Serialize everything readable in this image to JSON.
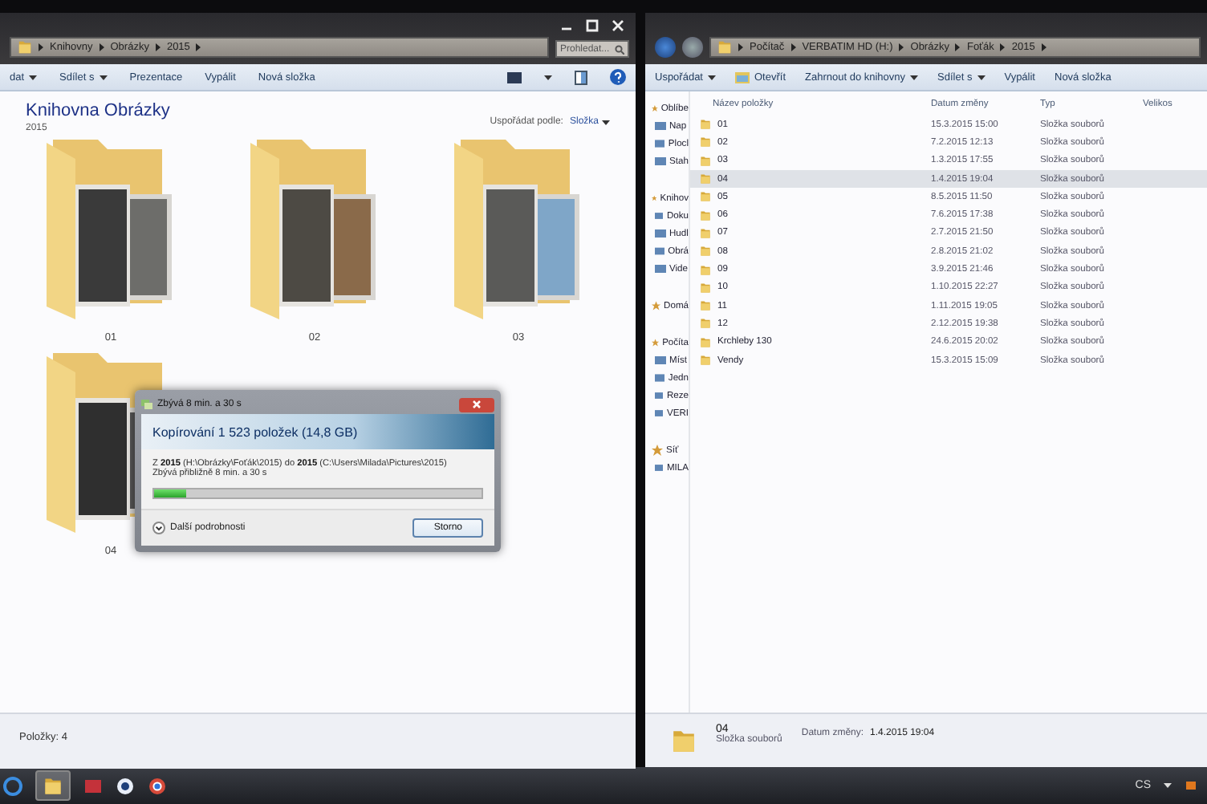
{
  "left_window": {
    "breadcrumbs": [
      "Knihovny",
      "Obrázky",
      "2015"
    ],
    "search": {
      "placeholder": "Prohledat..."
    },
    "toolbar": [
      {
        "label": "dat",
        "dropdown": true
      },
      {
        "label": "Sdílet s",
        "dropdown": true
      },
      {
        "label": "Prezentace",
        "dropdown": false
      },
      {
        "label": "Vypálit",
        "dropdown": false
      },
      {
        "label": "Nová složka",
        "dropdown": false
      }
    ],
    "library_title": "Knihovna Obrázky",
    "library_subtitle": "2015",
    "arrange_label": "Uspořádat podle:",
    "arrange_value": "Složka",
    "folders": [
      {
        "label": "01"
      },
      {
        "label": "02"
      },
      {
        "label": "03"
      },
      {
        "label": "04"
      }
    ],
    "status_bar": "Položky: 4"
  },
  "copy_dialog": {
    "title": "Zbývá 8 min. a 30 s",
    "heading": "Kopírování 1 523 položek (14,8 GB)",
    "source_line": "Z **2015** (H:\\Obrázky\\Foťák\\2015) do **2015** (C:\\Users\\Milada\\Pictures\\2015)",
    "remaining": "Zbývá přibližně 8 min. a 30 s",
    "progress": {
      "level": 0.1
    },
    "details_toggle": "Další podrobnosti",
    "cancel_button": "Storno"
  },
  "right_window": {
    "breadcrumbs": [
      "Počítač",
      "VERBATIM HD (H:)",
      "Obrázky",
      "Foťák",
      "2015"
    ],
    "toolbar": [
      {
        "label": "Uspořádat",
        "dropdown": true,
        "kind": "text"
      },
      {
        "label": "Otevřít",
        "dropdown": false,
        "kind": "icon"
      },
      {
        "label": "Zahrnout do knihovny",
        "dropdown": true,
        "kind": "text"
      },
      {
        "label": "Sdílet s",
        "dropdown": true,
        "kind": "text"
      },
      {
        "label": "Vypálit",
        "dropdown": false,
        "kind": "text"
      },
      {
        "label": "Nová složka",
        "dropdown": false,
        "kind": "text"
      }
    ],
    "nav_groups": [
      [
        {
          "label": "Oblíbe",
          "kind": "root"
        },
        {
          "label": "Nap",
          "kind": "child"
        },
        {
          "label": "Plocl",
          "kind": "child"
        },
        {
          "label": "Stah",
          "kind": "child"
        }
      ],
      [
        {
          "label": "Knihov",
          "kind": "root"
        },
        {
          "label": "Doku",
          "kind": "child"
        },
        {
          "label": "Hudl",
          "kind": "child"
        },
        {
          "label": "Obrá",
          "kind": "child"
        },
        {
          "label": "Vide",
          "kind": "child"
        }
      ],
      [
        {
          "label": "Domá",
          "kind": "root"
        }
      ],
      [
        {
          "label": "Počíta",
          "kind": "root"
        },
        {
          "label": "Míst",
          "kind": "child"
        },
        {
          "label": "Jedn",
          "kind": "child"
        },
        {
          "label": "Reze",
          "kind": "child"
        },
        {
          "label": "VERI",
          "kind": "child"
        }
      ],
      [
        {
          "label": "Síť",
          "kind": "root"
        },
        {
          "label": "MILA",
          "kind": "child"
        }
      ]
    ],
    "columns": [
      "Název položky",
      "Datum změny",
      "Typ",
      "Velikos"
    ],
    "rows": [
      {
        "name": "01",
        "date": "15.3.2015 15:00",
        "type": "Složka souborů",
        "selected": false
      },
      {
        "name": "02",
        "date": "7.2.2015 12:13",
        "type": "Složka souborů",
        "selected": false
      },
      {
        "name": "03",
        "date": "1.3.2015 17:55",
        "type": "Složka souborů",
        "selected": false
      },
      {
        "name": "04",
        "date": "1.4.2015 19:04",
        "type": "Složka souborů",
        "selected": true
      },
      {
        "name": "05",
        "date": "8.5.2015 11:50",
        "type": "Složka souborů",
        "selected": false
      },
      {
        "name": "06",
        "date": "7.6.2015 17:38",
        "type": "Složka souborů",
        "selected": false
      },
      {
        "name": "07",
        "date": "2.7.2015 21:50",
        "type": "Složka souborů",
        "selected": false
      },
      {
        "name": "08",
        "date": "2.8.2015 21:02",
        "type": "Složka souborů",
        "selected": false
      },
      {
        "name": "09",
        "date": "3.9.2015 21:46",
        "type": "Složka souborů",
        "selected": false
      },
      {
        "name": "10",
        "date": "1.10.2015 22:27",
        "type": "Složka souborů",
        "selected": false
      },
      {
        "name": "11",
        "date": "1.11.2015 19:05",
        "type": "Složka souborů",
        "selected": false
      },
      {
        "name": "12",
        "date": "2.12.2015 19:38",
        "type": "Složka souborů",
        "selected": false
      },
      {
        "name": "Krchleby 130",
        "date": "24.6.2015 20:02",
        "type": "Složka souborů",
        "selected": false
      },
      {
        "name": "Vendy",
        "date": "15.3.2015 15:09",
        "type": "Složka souborů",
        "selected": false
      }
    ],
    "details": {
      "name": "04",
      "type": "Složka souborů",
      "date_label": "Datum změny:",
      "date": "1.4.2015 19:04"
    }
  },
  "taskbar": {
    "language": "CS"
  }
}
